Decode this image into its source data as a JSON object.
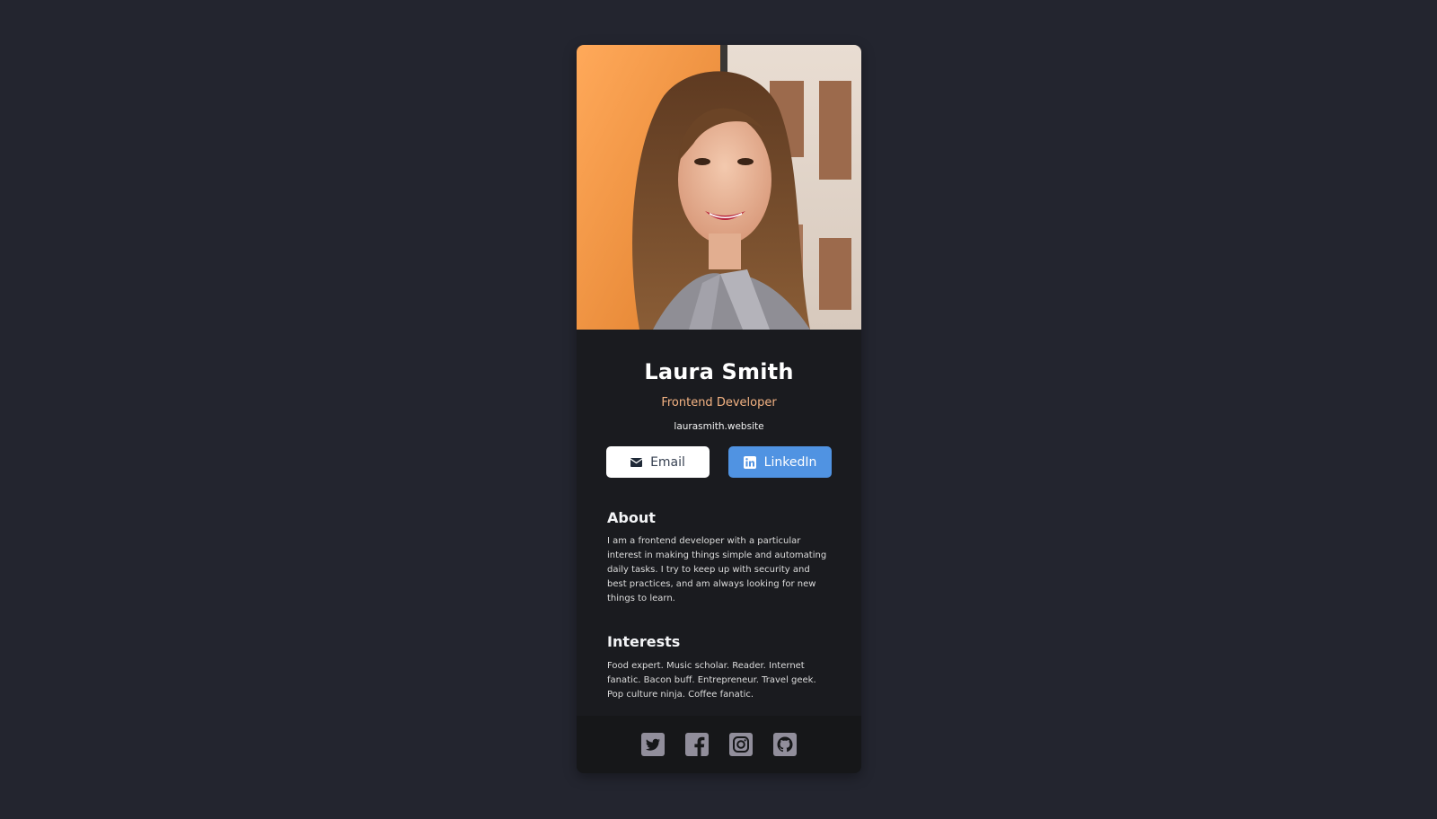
{
  "profile": {
    "name": "Laura Smith",
    "title": "Frontend Developer",
    "website": "laurasmith.website"
  },
  "buttons": {
    "email_label": "Email",
    "linkedin_label": "LinkedIn"
  },
  "about": {
    "heading": "About",
    "text": "I am a frontend developer with a particular interest in making things simple and automating daily tasks. I try to keep up with security and best practices, and am always looking for new things to learn."
  },
  "interests": {
    "heading": "Interests",
    "text": "Food expert. Music scholar. Reader. Internet fanatic. Bacon buff. Entrepreneur. Travel geek. Pop culture ninja. Coffee fanatic."
  },
  "footer": {
    "icons": [
      "twitter-icon",
      "facebook-icon",
      "instagram-icon",
      "github-icon"
    ]
  },
  "colors": {
    "page_background": "#23252f",
    "card_background": "#1a1b1f",
    "footer_background": "#161719",
    "accent_title": "#f4b383",
    "linkedin_button": "#5093e2",
    "email_button": "#ffffff",
    "social_icon": "#918e9b"
  }
}
